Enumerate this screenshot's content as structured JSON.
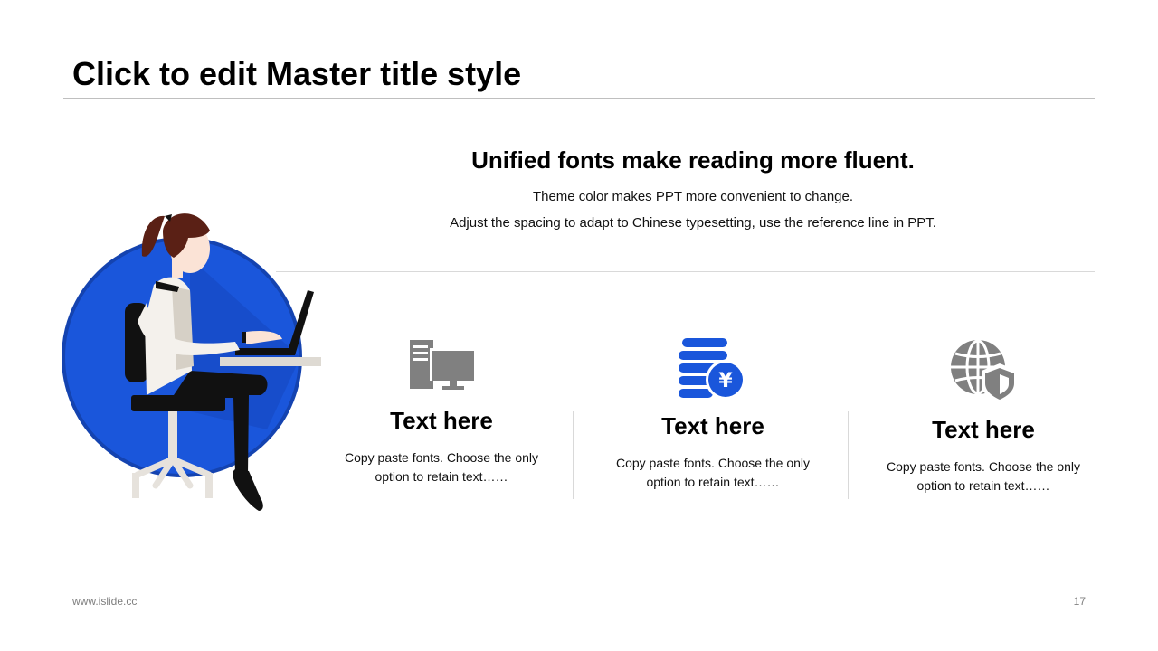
{
  "slide": {
    "title": "Click to edit Master title style",
    "headline": "Unified fonts make reading more fluent.",
    "sublines": [
      "Theme color makes PPT more convenient to change.",
      "Adjust the spacing to adapt to Chinese typesetting, use the reference line in PPT."
    ],
    "columns": [
      {
        "icon": "computer-icon",
        "heading": "Text here",
        "desc_line1": "Copy paste fonts. Choose the only",
        "desc_line2": "option to retain text……"
      },
      {
        "icon": "yen-coins-icon",
        "heading": "Text here",
        "desc_line1": "Copy paste fonts. Choose the only",
        "desc_line2": "option to retain text……"
      },
      {
        "icon": "globe-shield-icon",
        "heading": "Text here",
        "desc_line1": "Copy paste fonts. Choose the only",
        "desc_line2": "option to retain text……"
      }
    ],
    "footer": {
      "website": "www.islide.cc",
      "page_number": "17"
    }
  },
  "colors": {
    "accent_blue": "#1a56db",
    "icon_gray": "#808080",
    "rule_gray": "#d9d9d9"
  }
}
